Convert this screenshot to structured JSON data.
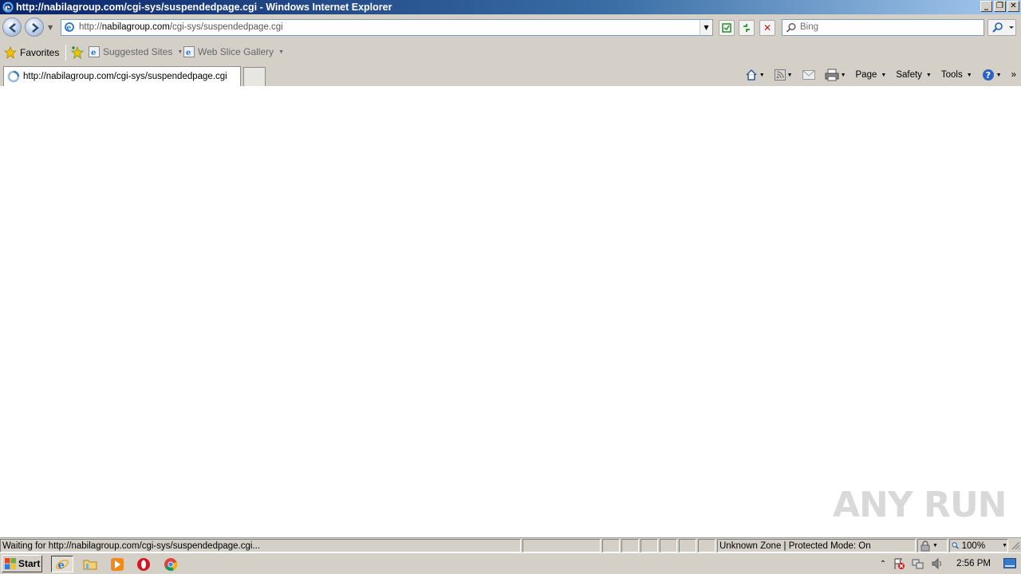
{
  "window": {
    "title": "http://nabilagroup.com/cgi-sys/suspendedpage.cgi - Windows Internet Explorer",
    "minimize": "_",
    "restore": "❐",
    "close": "✕"
  },
  "address_bar": {
    "url_prefix": "http://",
    "url_host": "nabilagroup.com",
    "url_path": "/cgi-sys/suspendedpage.cgi"
  },
  "search": {
    "placeholder": "Bing"
  },
  "favorites_bar": {
    "favorites_label": "Favorites",
    "items": [
      {
        "label": "Suggested Sites"
      },
      {
        "label": "Web Slice Gallery"
      }
    ]
  },
  "tabs": [
    {
      "label": "http://nabilagroup.com/cgi-sys/suspendedpage.cgi",
      "active": true
    }
  ],
  "command_bar": {
    "page": "Page",
    "safety": "Safety",
    "tools": "Tools",
    "more": "»"
  },
  "watermark": {
    "text": "ANY RUN"
  },
  "status_bar": {
    "status_text": "Waiting for http://nabilagroup.com/cgi-sys/suspendedpage.cgi...",
    "zone": "Unknown Zone | Protected Mode: On",
    "zoom": "100%"
  },
  "taskbar": {
    "start_label": "Start",
    "clock": "2:56 PM"
  },
  "colors": {
    "titlebar_start": "#0a246a",
    "titlebar_end": "#a6caf0",
    "chrome": "#d4d0c8"
  }
}
